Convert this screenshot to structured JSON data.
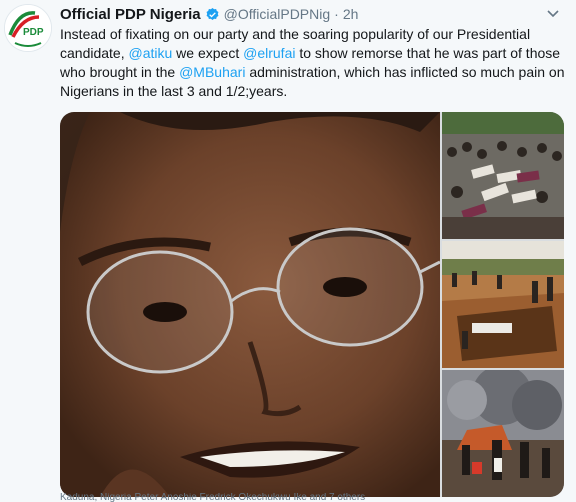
{
  "tweet": {
    "display_name": "Official PDP Nigeria",
    "handle": "@OfficialPDPNig",
    "separator": "·",
    "time": "2h",
    "body": {
      "t1": "Instead of fixating on our party and the soaring popularity of our Presidential candidate, ",
      "m1": "@atiku",
      "t2": " we expect ",
      "m2": "@elrufai",
      "t3": " to show remorse that he was part of those who brought in the ",
      "m3": "@MBuhari",
      "t4": " administration, which has inflicted so much pain on Nigerians in the last 3 and 1/2;years."
    },
    "avatar_text": "PDP",
    "tag_line": "Kaduna, Nigeria   Peter Anoshie  Fredrick Okechukwu Ike and 7 others"
  },
  "colors": {
    "link": "#1da1f2",
    "muted": "#657786",
    "verified": "#1da1f2",
    "pdp_green": "#1b8b3a",
    "pdp_red": "#d71f26"
  },
  "icons": [
    "verified-badge-icon",
    "chevron-down-icon",
    "pdp-logo-icon"
  ]
}
